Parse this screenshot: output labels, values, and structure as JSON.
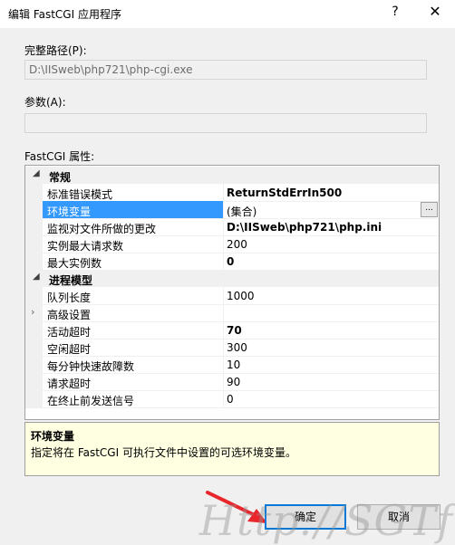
{
  "window": {
    "title": "编辑 FastCGI 应用程序",
    "help": "?",
    "close": "✕"
  },
  "full_path": {
    "label": "完整路径(P):",
    "value": "D:\\IISweb\\php721\\php-cgi.exe"
  },
  "arguments": {
    "label": "参数(A):",
    "value": ""
  },
  "properties": {
    "label": "FastCGI 属性:",
    "categories": [
      {
        "name": "常规",
        "items": [
          {
            "name": "标准错误模式",
            "value": "ReturnStdErrIn500",
            "bold": true
          },
          {
            "name": "环境变量",
            "value": "(集合)",
            "bold": false,
            "selected": true,
            "ellipsis": "..."
          },
          {
            "name": "监视对文件所做的更改",
            "value": "D:\\IISweb\\php721\\php.ini",
            "bold": true
          },
          {
            "name": "实例最大请求数",
            "value": "200",
            "bold": false
          },
          {
            "name": "最大实例数",
            "value": "0",
            "bold": true
          }
        ]
      },
      {
        "name": "进程模型",
        "items": [
          {
            "name": "队列长度",
            "value": "1000",
            "bold": false
          },
          {
            "name": "高级设置",
            "value": "",
            "bold": false,
            "expandable": true
          },
          {
            "name": "活动超时",
            "value": "70",
            "bold": true
          },
          {
            "name": "空闲超时",
            "value": "300",
            "bold": false
          },
          {
            "name": "每分钟快速故障数",
            "value": "10",
            "bold": false
          },
          {
            "name": "请求超时",
            "value": "90",
            "bold": false
          },
          {
            "name": "在终止前发送信号",
            "value": "0",
            "bold": false
          }
        ]
      }
    ]
  },
  "description": {
    "title": "环境变量",
    "text": "指定将在 FastCGI 可执行文件中设置的可选环境变量。"
  },
  "buttons": {
    "ok": "确定",
    "cancel": "取消"
  },
  "watermark": "Http://SGTf.cn"
}
